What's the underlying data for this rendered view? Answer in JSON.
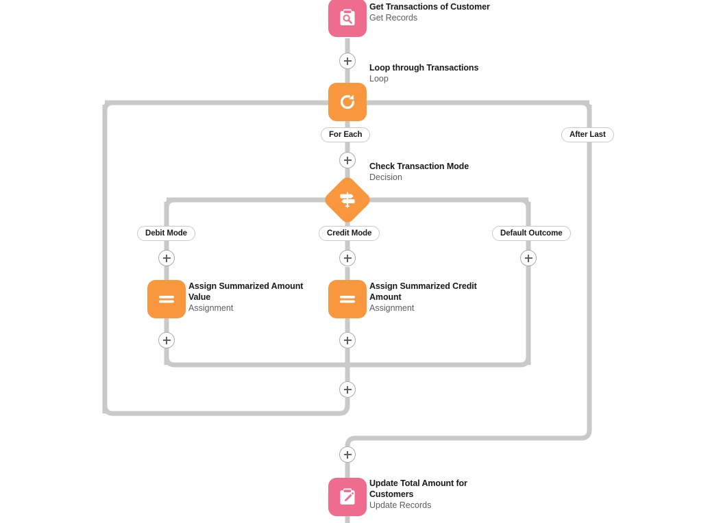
{
  "flow": {
    "canvas_name": "flow-canvas",
    "colors": {
      "get_records": "#ee6c8e",
      "update_records": "#ee6c8e",
      "loop": "#f9973f",
      "decision": "#f9973f",
      "assignment": "#f9973f",
      "connector": "#c9c9c9",
      "title_text": "#181818",
      "subtitle_text": "#5c5c5c"
    },
    "nodes": [
      {
        "id": "get-transactions",
        "title": "Get Transactions of Customer",
        "subtitle": "Get Records",
        "icon": "get-records-icon",
        "type": "get-records"
      },
      {
        "id": "loop-transactions",
        "title": "Loop through Transactions",
        "subtitle": "Loop",
        "icon": "loop-icon",
        "type": "loop"
      },
      {
        "id": "check-transaction-mode",
        "title": "Check Transaction Mode",
        "subtitle": "Decision",
        "icon": "decision-icon",
        "type": "decision"
      },
      {
        "id": "assign-summarized-amount-value",
        "title": "Assign Summarized Amount Value",
        "subtitle": "Assignment",
        "icon": "assignment-icon",
        "type": "assignment"
      },
      {
        "id": "assign-summarized-credit-amount",
        "title": "Assign Summarized Credit Amount",
        "subtitle": "Assignment",
        "icon": "assignment-icon",
        "type": "assignment"
      },
      {
        "id": "update-total-amount",
        "title": "Update Total Amount for Customers",
        "subtitle": "Update Records",
        "icon": "update-records-icon",
        "type": "update-records"
      }
    ],
    "branch_labels": {
      "for_each": "For Each",
      "after_last": "After Last",
      "debit_mode": "Debit Mode",
      "credit_mode": "Credit Mode",
      "default_outcome": "Default Outcome"
    },
    "add_buttons": [
      {
        "id": "add-after-get-records"
      },
      {
        "id": "add-after-loop-for-each"
      },
      {
        "id": "add-debit-branch-top"
      },
      {
        "id": "add-credit-branch-top"
      },
      {
        "id": "add-default-branch-top"
      },
      {
        "id": "add-debit-branch-bottom"
      },
      {
        "id": "add-credit-branch-bottom"
      },
      {
        "id": "add-after-decision-merge"
      },
      {
        "id": "add-before-update-records"
      }
    ]
  }
}
